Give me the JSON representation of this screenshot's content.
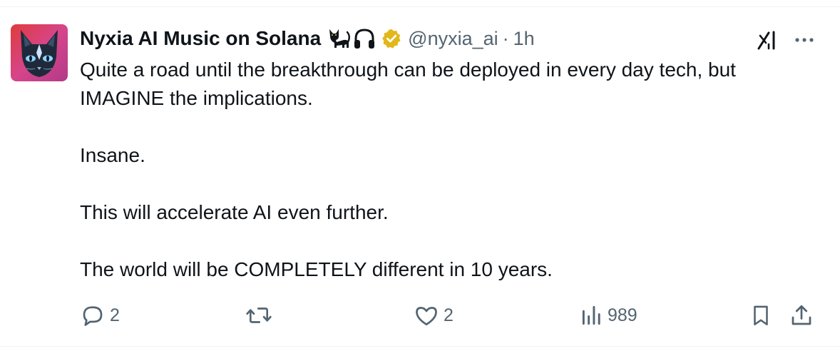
{
  "author": {
    "display_name": "Nyxia AI Music on Solana",
    "emojis": [
      "black-cat-emoji",
      "headphone-emoji"
    ],
    "verified": true,
    "verified_color": "#e2b719",
    "handle": "@nyxia_ai",
    "separator": "·",
    "timestamp": "1h"
  },
  "tweet": {
    "paragraphs": [
      "Quite a road until the breakthrough can be deployed in every day tech, but IMAGINE the implications.",
      "Insane.",
      "This will accelerate AI even further.",
      "The world will be COMPLETELY different in 10 years."
    ]
  },
  "actions": {
    "reply_count": "2",
    "repost_count": "",
    "like_count": "2",
    "views_count": "989"
  },
  "colors": {
    "text": "#0f1419",
    "secondary": "#536471",
    "divider": "#eff3f4"
  }
}
